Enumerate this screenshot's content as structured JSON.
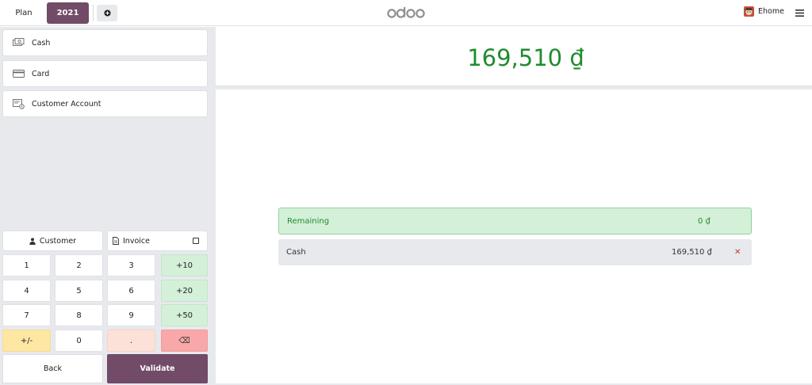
{
  "topbar": {
    "tab_plan": "Plan",
    "tab_current": "2021",
    "add_tab_icon": "plus-circle-icon",
    "logo": "odoo",
    "user_name": "Ehome",
    "menu_icon": "hamburger-icon",
    "colors": {
      "accent": "#714b67"
    }
  },
  "payment_methods": [
    {
      "label": "Cash",
      "icon": "cash-icon"
    },
    {
      "label": "Card",
      "icon": "card-icon"
    },
    {
      "label": "Customer Account",
      "icon": "customer-account-icon"
    }
  ],
  "actions": {
    "customer_label": "Customer",
    "invoice_label": "Invoice",
    "invoice_checked": false
  },
  "numpad": {
    "k1": "1",
    "k2": "2",
    "k3": "3",
    "p10": "+10",
    "k4": "4",
    "k5": "5",
    "k6": "6",
    "p20": "+20",
    "k7": "7",
    "k8": "8",
    "k9": "9",
    "p50": "+50",
    "sign": "+/-",
    "k0": "0",
    "dot": ".",
    "backspace": "⌫"
  },
  "footer": {
    "back_label": "Back",
    "validate_label": "Validate"
  },
  "summary": {
    "total": "169,510 ₫",
    "remaining_label": "Remaining",
    "remaining_amount": "0 ₫",
    "colors": {
      "amount": "#1f8c2e"
    }
  },
  "paymentlines": [
    {
      "method": "Cash",
      "amount": "169,510 ₫",
      "delete_icon": "close-icon"
    }
  ]
}
